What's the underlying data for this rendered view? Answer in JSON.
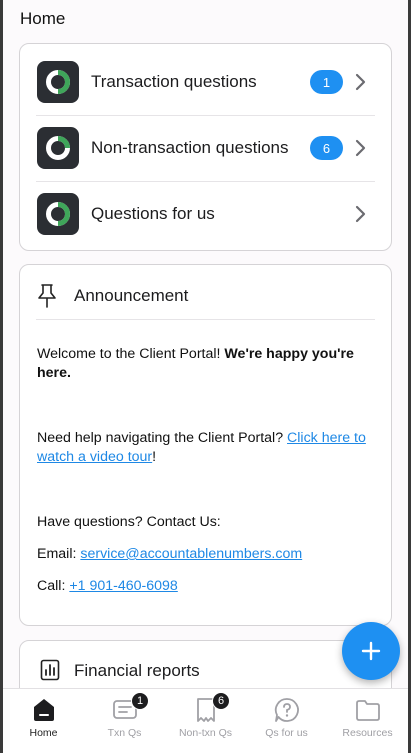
{
  "header": {
    "title": "Home"
  },
  "questions": [
    {
      "label": "Transaction questions",
      "badge": "1"
    },
    {
      "label": "Non-transaction questions",
      "badge": "6"
    },
    {
      "label": "Questions for us",
      "badge": null
    }
  ],
  "announcement": {
    "title": "Announcement",
    "welcome_text": "Welcome to the Client Portal! ",
    "welcome_bold": "We're happy you're here.",
    "help_text": "Need help navigating the Client Portal? ",
    "help_link": "Click here to watch a video tour",
    "help_suffix": "!",
    "contact_heading": "Have questions? Contact Us:",
    "email_label": "Email: ",
    "email_link": "service@accountablenumbers.com",
    "call_label": "Call: ",
    "phone_link": "+1 901-460-6098"
  },
  "financial_reports": {
    "title": "Financial reports"
  },
  "fab": {
    "icon": "plus-icon"
  },
  "tabs": [
    {
      "label": "Home",
      "icon": "home-icon",
      "badge": null,
      "active": true
    },
    {
      "label": "Txn Qs",
      "icon": "message-icon",
      "badge": "1",
      "active": false
    },
    {
      "label": "Non-txn Qs",
      "icon": "receipt-icon",
      "badge": "6",
      "active": false
    },
    {
      "label": "Qs for us",
      "icon": "help-chat-icon",
      "badge": null,
      "active": false
    },
    {
      "label": "Resources",
      "icon": "folder-icon",
      "badge": null,
      "active": false
    }
  ],
  "colors": {
    "accent": "#1e90f2",
    "icon_bg": "#2b2e33",
    "ring_green": "#3fa65a",
    "link": "#1e88e5"
  }
}
